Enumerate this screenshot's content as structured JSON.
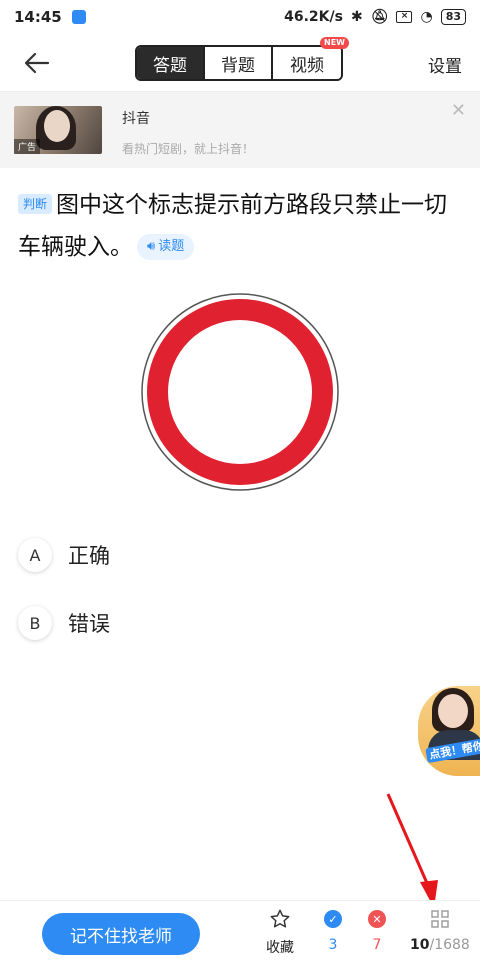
{
  "status_bar": {
    "time": "14:45",
    "speed": "46.2K/s",
    "battery": "83"
  },
  "header": {
    "tabs": [
      {
        "label": "答题",
        "active": true
      },
      {
        "label": "背题",
        "active": false
      },
      {
        "label": "视频",
        "active": false,
        "badge": "NEW"
      }
    ],
    "settings_label": "设置"
  },
  "ad": {
    "title": "抖音",
    "description": "看热门短剧，就上抖音！",
    "tag": "广告"
  },
  "question": {
    "type_tag": "判断",
    "text": "图中这个标志提示前方路段只禁止一切车辆驶入。",
    "read_label": "读题"
  },
  "options": [
    {
      "letter": "A",
      "text": "正确"
    },
    {
      "letter": "B",
      "text": "错误"
    }
  ],
  "teacher_tip": "点我！帮你讲",
  "bottom_bar": {
    "ask_teacher_label": "记不住找老师",
    "favorite_label": "收藏",
    "correct_count": "3",
    "wrong_count": "7",
    "current_index": "10",
    "total": "/1688"
  },
  "colors": {
    "accent": "#2e8bf3",
    "wrong": "#f05454",
    "sign_red": "#e0212f"
  }
}
